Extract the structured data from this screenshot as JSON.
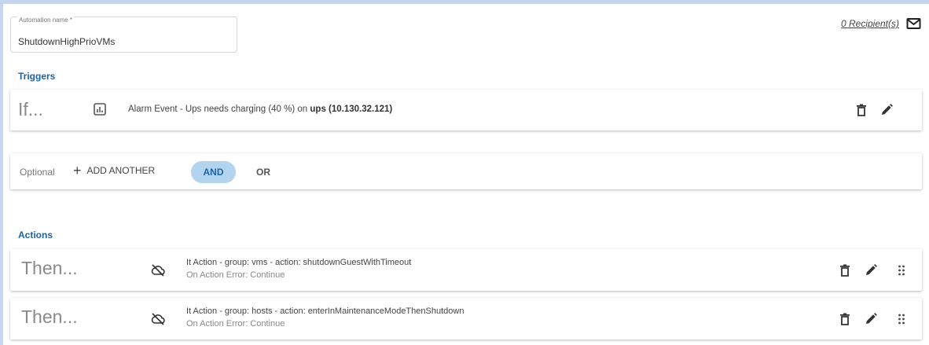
{
  "automation": {
    "name_label": "Automation name *",
    "name_value": "ShutdownHighPrioVMs",
    "recipients": "0 Recipient(s)"
  },
  "triggers": {
    "title": "Triggers",
    "items": [
      {
        "prefix": "If...",
        "text_before": "Alarm Event - Ups needs charging (40 %) on ",
        "text_bold": "ups (10.130.32.121)",
        "icon": "chart-icon"
      }
    ],
    "optional_label": "Optional",
    "add_another": "ADD ANOTHER",
    "and_label": "AND",
    "or_label": "OR"
  },
  "actions": {
    "title": "Actions",
    "items": [
      {
        "prefix": "Then...",
        "text": "It Action - group: vms - action: shutdownGuestWithTimeout",
        "sub": "On Action Error: Continue",
        "icon": "cloud-off-icon"
      },
      {
        "prefix": "Then...",
        "text": "It Action - group: hosts - action: enterInMaintenanceModeThenShutdown",
        "sub": "On Action Error: Continue",
        "icon": "cloud-off-icon"
      }
    ]
  },
  "colors": {
    "accent": "#1a63a8",
    "pill_bg": "#b3d4ef",
    "frame": "#c5d6ee"
  }
}
